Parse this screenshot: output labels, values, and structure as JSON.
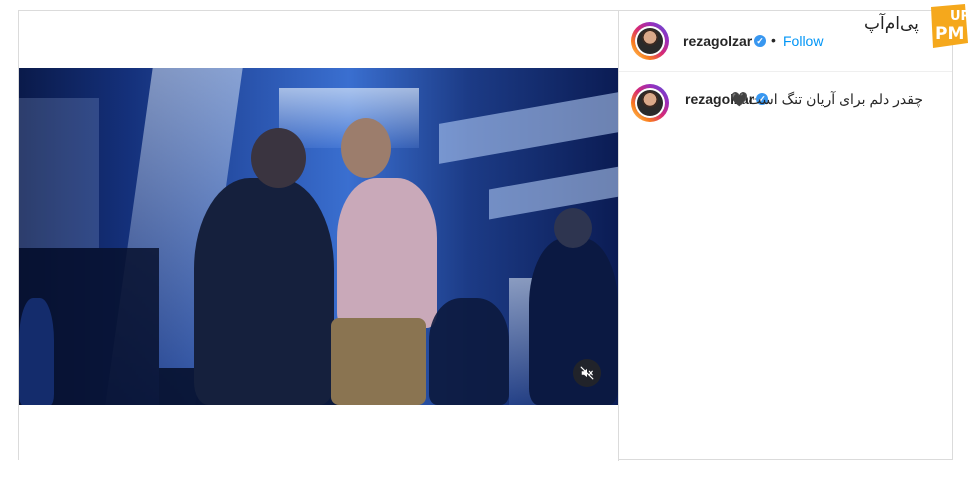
{
  "post": {
    "username": "rezagolzar",
    "verified": true,
    "separator": "•",
    "follow_label": "Follow",
    "caption_user": "rezagolzar",
    "caption_text": "چقدر دلم برای آریان تنگ است🖤"
  },
  "video": {
    "muted": true,
    "mute_icon": "speaker-muted-icon"
  },
  "watermark": {
    "text": "پی‌ام‌آپ",
    "badge_text": "PM UP",
    "colors": {
      "badge": "#f5a81c",
      "text": "#222222"
    }
  },
  "colors": {
    "accent": "#0095f6",
    "verified": "#3897f0",
    "border": "#dbdbdb"
  }
}
